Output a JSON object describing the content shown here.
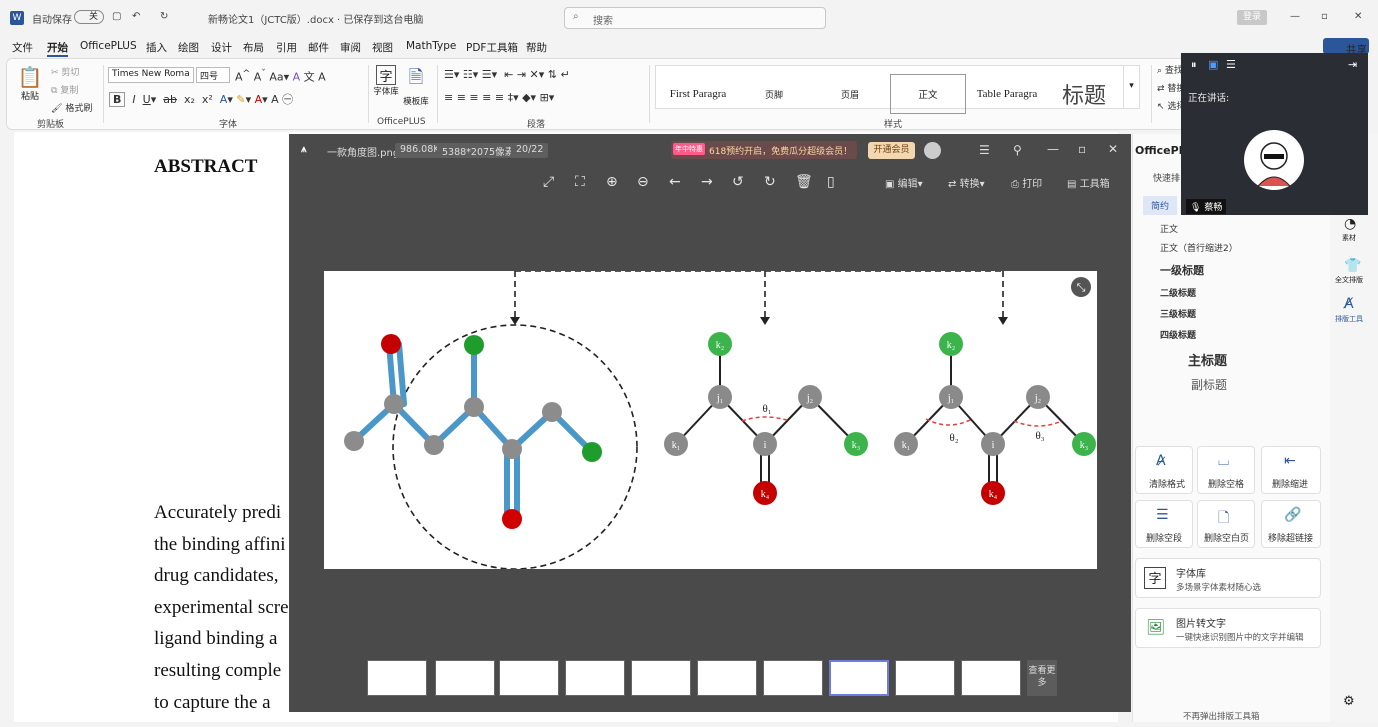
{
  "titlebar": {
    "autosave": "自动保存",
    "autosave_state": "关",
    "doc_title": "新畅论文1（JCTC版）.docx · 已保存到这台电脑",
    "search_placeholder": "搜索",
    "login": "登录",
    "share": "共享"
  },
  "menu": [
    "文件",
    "开始",
    "OfficePLUS",
    "插入",
    "绘图",
    "设计",
    "布局",
    "引用",
    "邮件",
    "审阅",
    "视图",
    "MathType",
    "PDF工具箱",
    "帮助"
  ],
  "ribbon": {
    "clipboard": {
      "paste": "粘贴",
      "cut": "剪切",
      "copy": "复制",
      "format_painter": "格式刷",
      "label": "剪贴板"
    },
    "font": {
      "name": "Times New Roma",
      "size": "四号",
      "label": "字体"
    },
    "officeplus": {
      "font_lib": "字体库",
      "template_lib": "模板库",
      "label": "OfficePLUS"
    },
    "paragraph": {
      "label": "段落"
    },
    "styles": {
      "items": [
        "First Paragra",
        "页脚",
        "页眉",
        "正文",
        "Table Paragra",
        "标题"
      ],
      "label": "样式"
    },
    "editing": {
      "find": "查找",
      "replace": "替换",
      "select": "选择"
    }
  },
  "document": {
    "heading": "ABSTRACT",
    "lines": [
      "Accurately predi",
      "the binding affini",
      "drug candidates,",
      "experimental scre",
      "ligand binding a",
      "resulting comple",
      "to capture the a"
    ]
  },
  "viewer": {
    "filename": "一款角度图.png",
    "filesize": "986.08K",
    "resolution": "5388*2075像素",
    "index": "20/22",
    "promo_badge": "年中特惠",
    "promo": "618预约开启，免费瓜分超级会员！",
    "vip": "开通会员",
    "edit": "编辑",
    "convert": "转换",
    "print": "打印",
    "toolbox": "工具箱",
    "more": "查看更多"
  },
  "figure": {
    "labels1": {
      "k2": "k₂",
      "j1": "j₁",
      "j2": "j₂",
      "k1": "k₁",
      "i": "i",
      "k3": "k₃",
      "k4": "k₄",
      "theta": "θ₁"
    },
    "labels2": {
      "k2": "k₂",
      "j1": "j₁",
      "j2": "j₂",
      "k1": "k₁",
      "i": "i",
      "k3": "k₃",
      "k4": "k₄",
      "theta2": "θ₂",
      "theta3": "θ₃"
    }
  },
  "sidepane": {
    "title": "OfficePLUS",
    "quick": "快速排",
    "tab": "简约",
    "styles": [
      "正文",
      "正文（首行缩进2）",
      "一级标题",
      "二级标题",
      "三级标题",
      "四级标题",
      "主标题",
      "副标题"
    ],
    "tools": [
      "清除格式",
      "删除空格",
      "删除缩进",
      "删除空段",
      "删除空白页",
      "移除超链接"
    ],
    "font_lib": {
      "title": "字体库",
      "desc": "多场景字体素材随心选"
    },
    "ocr": {
      "title": "图片转文字",
      "desc": "一键快速识别图片中的文字并编辑"
    },
    "footer": "不再弹出排版工具箱"
  },
  "rightstrip": [
    "素材",
    "全文排版",
    "排版工具"
  ],
  "video": {
    "speaking": "正在讲话:",
    "name": "蔡畅"
  },
  "colors": {
    "accent": "#2b579a",
    "green": "#3cb44b",
    "red": "#c40000",
    "gray": "#8a8a8a",
    "bond": "#3d8fc2"
  }
}
